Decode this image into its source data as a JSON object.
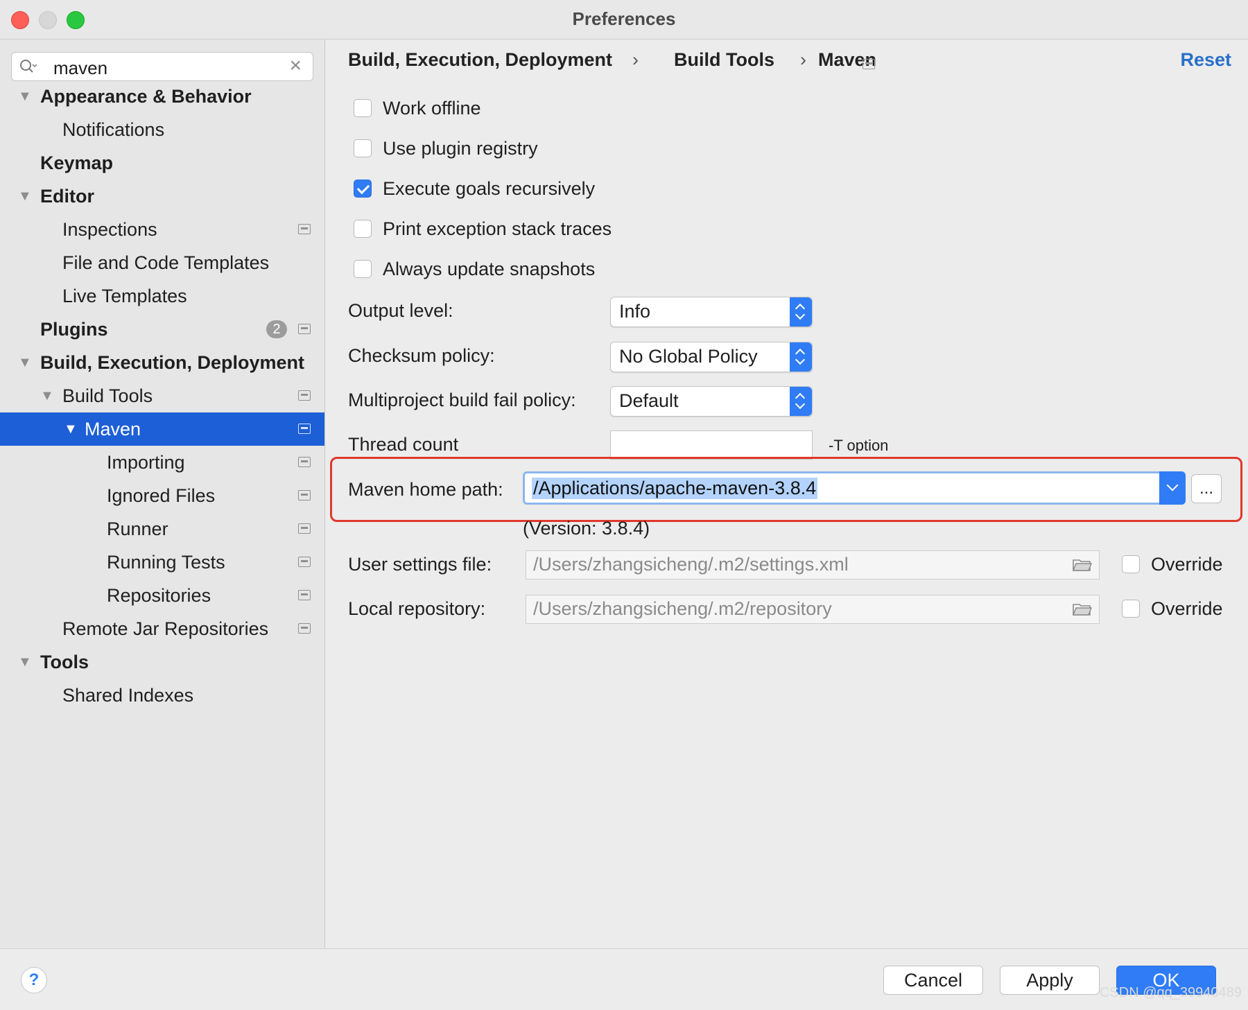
{
  "window": {
    "title": "Preferences"
  },
  "search": {
    "query": "maven"
  },
  "sidebar": {
    "items": [
      {
        "label": "Appearance & Behavior"
      },
      {
        "label": "Notifications"
      },
      {
        "label": "Keymap"
      },
      {
        "label": "Editor"
      },
      {
        "label": "Inspections"
      },
      {
        "label": "File and Code Templates"
      },
      {
        "label": "Live Templates"
      },
      {
        "label": "Plugins",
        "badge": "2"
      },
      {
        "label": "Build, Execution, Deployment"
      },
      {
        "label": "Build Tools"
      },
      {
        "label": "Maven"
      },
      {
        "label": "Importing"
      },
      {
        "label": "Ignored Files"
      },
      {
        "label": "Runner"
      },
      {
        "label": "Running Tests"
      },
      {
        "label": "Repositories"
      },
      {
        "label": "Remote Jar Repositories"
      },
      {
        "label": "Tools"
      },
      {
        "label": "Shared Indexes"
      }
    ]
  },
  "breadcrumb": {
    "part1": "Build, Execution, Deployment",
    "part2": "Build Tools",
    "part3": "Maven",
    "sep": "›"
  },
  "reset_label": "Reset",
  "checkboxes": [
    {
      "label": "Work offline",
      "checked": false
    },
    {
      "label": "Use plugin registry",
      "checked": false
    },
    {
      "label": "Execute goals recursively",
      "checked": true
    },
    {
      "label": "Print exception stack traces",
      "checked": false
    },
    {
      "label": "Always update snapshots",
      "checked": false
    }
  ],
  "fields": {
    "output_level": {
      "label": "Output level:",
      "value": "Info"
    },
    "checksum_policy": {
      "label": "Checksum policy:",
      "value": "No Global Policy"
    },
    "multiproject": {
      "label": "Multiproject build fail policy:",
      "value": "Default"
    },
    "thread_count": {
      "label": "Thread count",
      "value": "",
      "hint": "-T option"
    },
    "maven_home": {
      "label": "Maven home path:",
      "value": "/Applications/apache-maven-3.8.4",
      "version": "(Version: 3.8.4)",
      "browse": "..."
    },
    "user_settings": {
      "label": "User settings file:",
      "value": "/Users/zhangsicheng/.m2/settings.xml",
      "override": "Override"
    },
    "local_repo": {
      "label": "Local repository:",
      "value": "/Users/zhangsicheng/.m2/repository",
      "override": "Override"
    }
  },
  "buttons": {
    "help": "?",
    "cancel": "Cancel",
    "apply": "Apply",
    "ok": "OK"
  },
  "watermark": "CSDN @qq_39940489",
  "colors": {
    "accent": "#2f7cf6",
    "selection": "#1d5fd6",
    "highlight_border": "#e0382b"
  }
}
